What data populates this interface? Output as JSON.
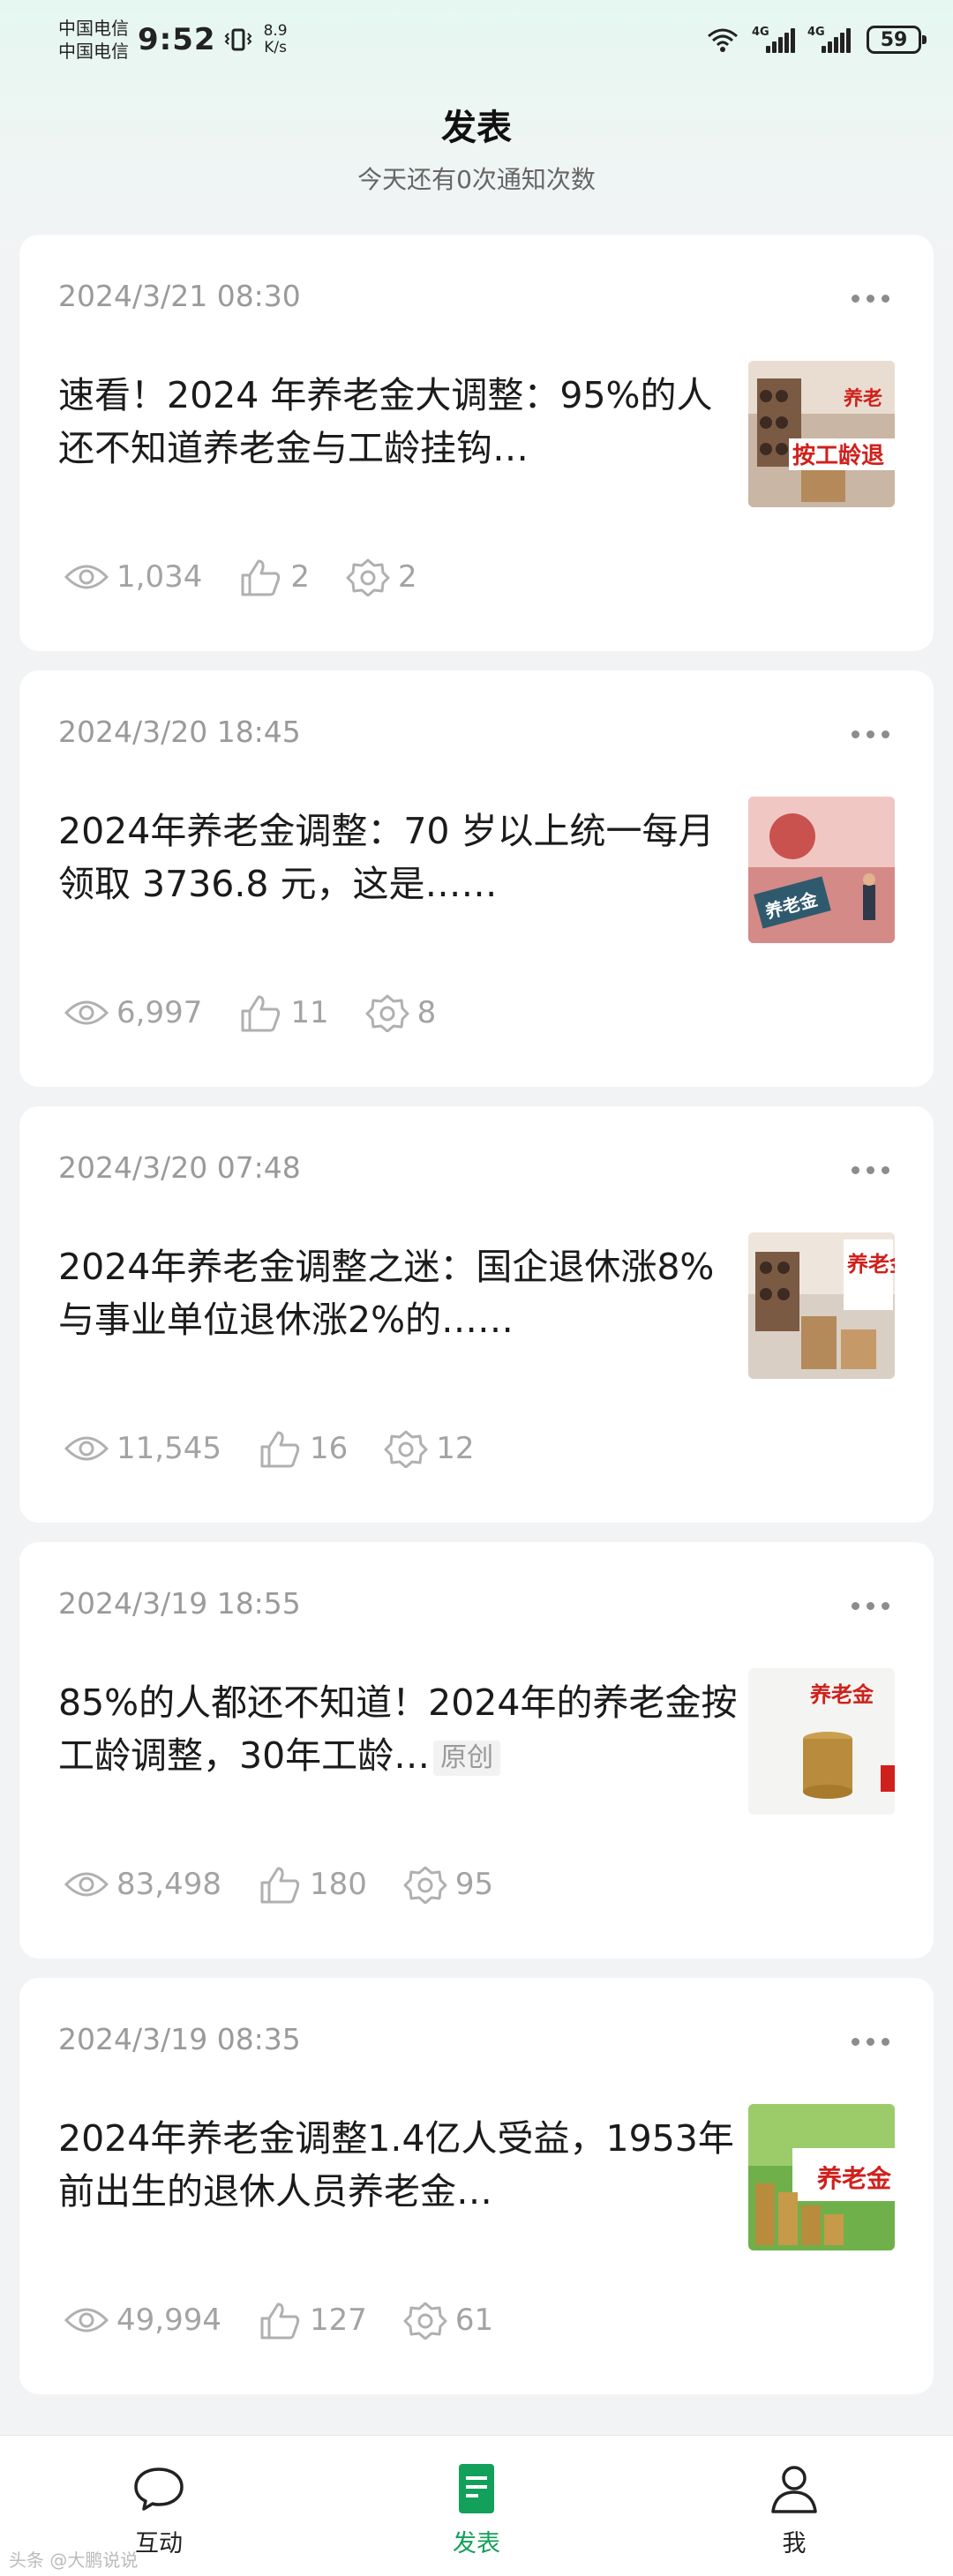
{
  "status_bar": {
    "carrier1": "中国电信",
    "carrier2": "中国电信",
    "time": "9:52",
    "net_speed_value": "8.9",
    "net_speed_unit": "K/s",
    "signal1_tag": "4G",
    "signal2_tag": "4G",
    "battery": "59"
  },
  "header": {
    "title": "发表",
    "subtitle": "今天还有0次通知次数"
  },
  "articles": [
    {
      "date": "2024/3/21 08:30",
      "title": "速看！2024 年养老金大调整：95%的人还不知道养老金与工龄挂钩…",
      "views": "1,034",
      "likes": "2",
      "shares": "2",
      "thumb_text": "按工龄退",
      "thumb_text2": "养老"
    },
    {
      "date": "2024/3/20 18:45",
      "title": "2024年养老金调整：70 岁以上统一每月领取 3736.8 元，这是……",
      "views": "6,997",
      "likes": "11",
      "shares": "8",
      "thumb_text": "养老金"
    },
    {
      "date": "2024/3/20 07:48",
      "title": "2024年养老金调整之迷：国企退休涨8%与事业单位退休涨2%的……",
      "views": "11,545",
      "likes": "16",
      "shares": "12",
      "thumb_text": "养老金"
    },
    {
      "date": "2024/3/19 18:55",
      "title": "85%的人都还不知道！2024年的养老金按工龄调整，30年工龄…",
      "tag": "原创",
      "views": "83,498",
      "likes": "180",
      "shares": "95",
      "thumb_text": "养老金"
    },
    {
      "date": "2024/3/19 08:35",
      "title": "2024年养老金调整1.4亿人受益，1953年前出生的退休人员养老金…",
      "views": "49,994",
      "likes": "127",
      "shares": "61",
      "thumb_text": "养老金"
    }
  ],
  "bottom_nav": [
    {
      "label": "互动",
      "icon": "chat-bubble-icon",
      "active": false
    },
    {
      "label": "发表",
      "icon": "document-icon",
      "active": true
    },
    {
      "label": "我",
      "icon": "person-icon",
      "active": false
    }
  ],
  "watermark": "头条 @大鹏说说",
  "colors": {
    "accent": "#12a05a",
    "meta_text": "#a3a3a3"
  }
}
